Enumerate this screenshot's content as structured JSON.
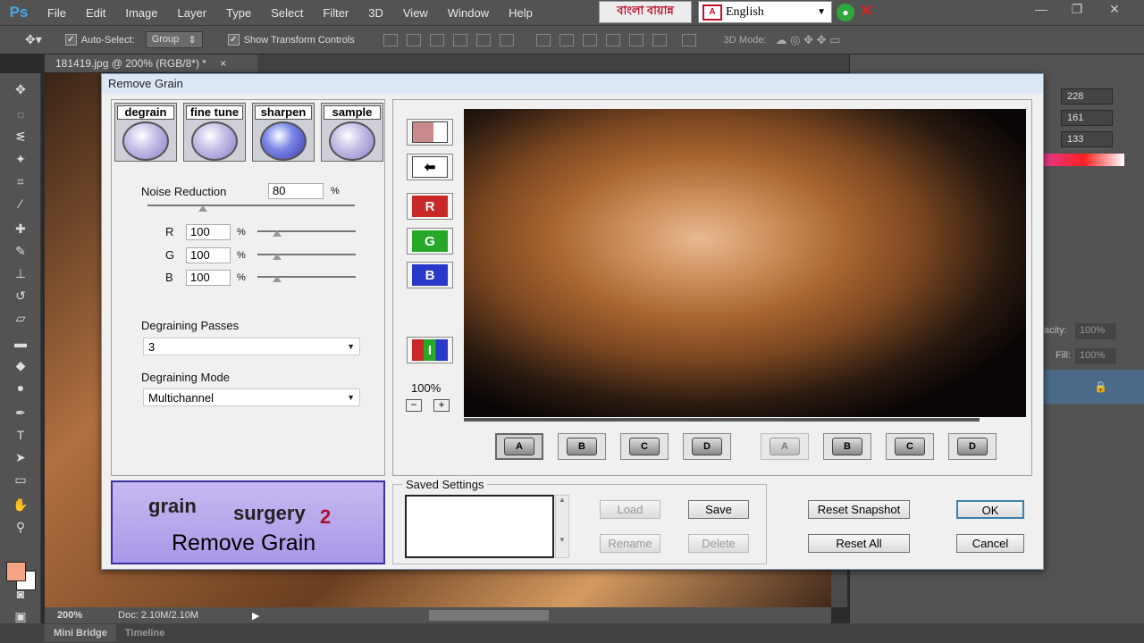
{
  "app": {
    "logo": "Ps",
    "menu": [
      "File",
      "Edit",
      "Image",
      "Layer",
      "Type",
      "Select",
      "Filter",
      "3D",
      "View",
      "Window",
      "Help"
    ],
    "bangla_text": "বাংলা বায়ান্ন",
    "language": "English"
  },
  "options_bar": {
    "auto_select_label": "Auto-Select:",
    "auto_select_value": "Group",
    "show_transform_label": "Show Transform Controls",
    "mode_3d_label": "3D Mode:"
  },
  "document": {
    "tab_title": "181419.jpg @ 200% (RGB/8*) *",
    "zoom": "200%",
    "doc_info": "Doc: 2.10M/2.10M"
  },
  "bottom_tabs": [
    "Mini Bridge",
    "Timeline"
  ],
  "right_panel": {
    "rgb": [
      "228",
      "161",
      "133"
    ],
    "opacity_label": "acity:",
    "opacity_value": "100%",
    "fill_label": "Fill:",
    "fill_value": "100%"
  },
  "dialog": {
    "title": "Remove Grain",
    "mode_tabs": [
      "degrain",
      "fine tune",
      "sharpen",
      "sample"
    ],
    "noise_reduction_label": "Noise Reduction",
    "noise_reduction_value": "80",
    "percent": "%",
    "channels": [
      {
        "label": "R",
        "value": "100"
      },
      {
        "label": "G",
        "value": "100"
      },
      {
        "label": "B",
        "value": "100"
      }
    ],
    "passes_label": "Degraining Passes",
    "passes_value": "3",
    "mode_label": "Degraining Mode",
    "mode_value": "Multichannel",
    "zoom_label": "100%",
    "side_buttons": {
      "r": "R",
      "g": "G",
      "b": "B"
    },
    "snapshots": [
      "A",
      "B",
      "C",
      "D"
    ],
    "store_snapshots": [
      "A",
      "B",
      "C",
      "D"
    ],
    "logo": {
      "grain": "grain",
      "surgery": "surgery",
      "version": "2",
      "subtitle": "Remove Grain"
    },
    "saved_settings_label": "Saved Settings",
    "buttons": {
      "load": "Load",
      "save": "Save",
      "rename": "Rename",
      "delete": "Delete",
      "reset_snapshot": "Reset Snapshot",
      "reset_all": "Reset All",
      "ok": "OK",
      "cancel": "Cancel"
    }
  },
  "colors": {
    "foreground": "#f5a583",
    "background": "#ffffff",
    "ps_blue": "#4aa8e8"
  }
}
